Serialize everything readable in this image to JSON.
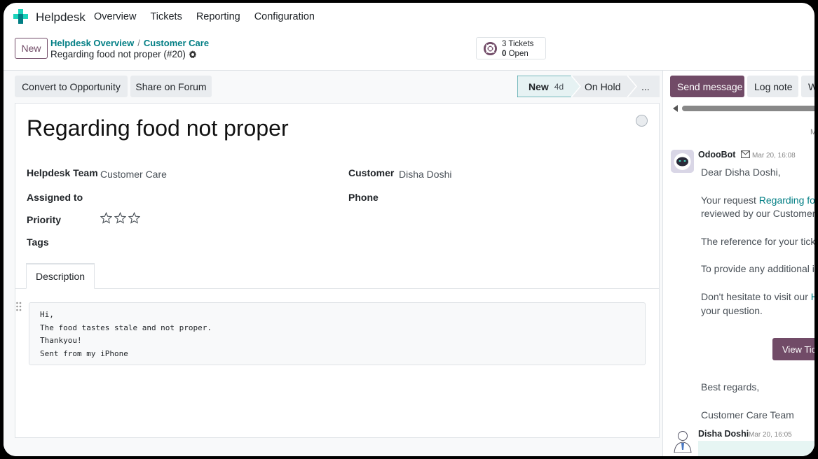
{
  "navbar": {
    "app_name": "Helpdesk",
    "menu": [
      "Overview",
      "Tickets",
      "Reporting",
      "Configuration"
    ]
  },
  "control": {
    "new_label": "New",
    "breadcrumb": [
      "Helpdesk Overview",
      "Customer Care"
    ],
    "breadcrumb_sep": "/",
    "record_title": "Regarding food not proper (#20)",
    "stat": {
      "tickets_count": "3",
      "tickets_label": "Tickets",
      "open_count": "0",
      "open_label": "Open"
    }
  },
  "actions": {
    "convert": "Convert to Opportunity",
    "share": "Share on Forum"
  },
  "stages": {
    "current": "New",
    "current_duration": "4d",
    "next": "On Hold",
    "more": "..."
  },
  "form": {
    "title": "Regarding food not proper",
    "fields": {
      "team_label": "Helpdesk Team",
      "team_value": "Customer Care",
      "assigned_label": "Assigned to",
      "priority_label": "Priority",
      "tags_label": "Tags",
      "customer_label": "Customer",
      "customer_value": "Disha Doshi",
      "phone_label": "Phone"
    },
    "tab_description": "Description",
    "description_lines": [
      "Hi,",
      "The food tastes stale and not proper.",
      "Thankyou!",
      "Sent from my iPhone"
    ]
  },
  "chatter": {
    "send_message": "Send message",
    "log_note": "Log note",
    "third_btn": "W",
    "separator_text": "M",
    "message1": {
      "author": "OdooBot",
      "date": "Mar 20, 16:08",
      "greeting": "Dear Disha Doshi,",
      "request_prefix": "Your request ",
      "request_link": "Regarding food",
      "reviewed": "reviewed by our Customer C",
      "reference": "The reference for your ticket",
      "provide": "To provide any additional in",
      "visit_prefix": "Don't hesitate to visit our ",
      "visit_link": "He",
      "question": "your question.",
      "view_button": "View Tic",
      "regards": "Best regards,",
      "signature": "Customer Care Team"
    },
    "message2": {
      "author": "Disha Doshi",
      "date": "Mar 20, 16:05"
    }
  },
  "colors": {
    "primary": "#714B67",
    "link": "#017e84"
  }
}
